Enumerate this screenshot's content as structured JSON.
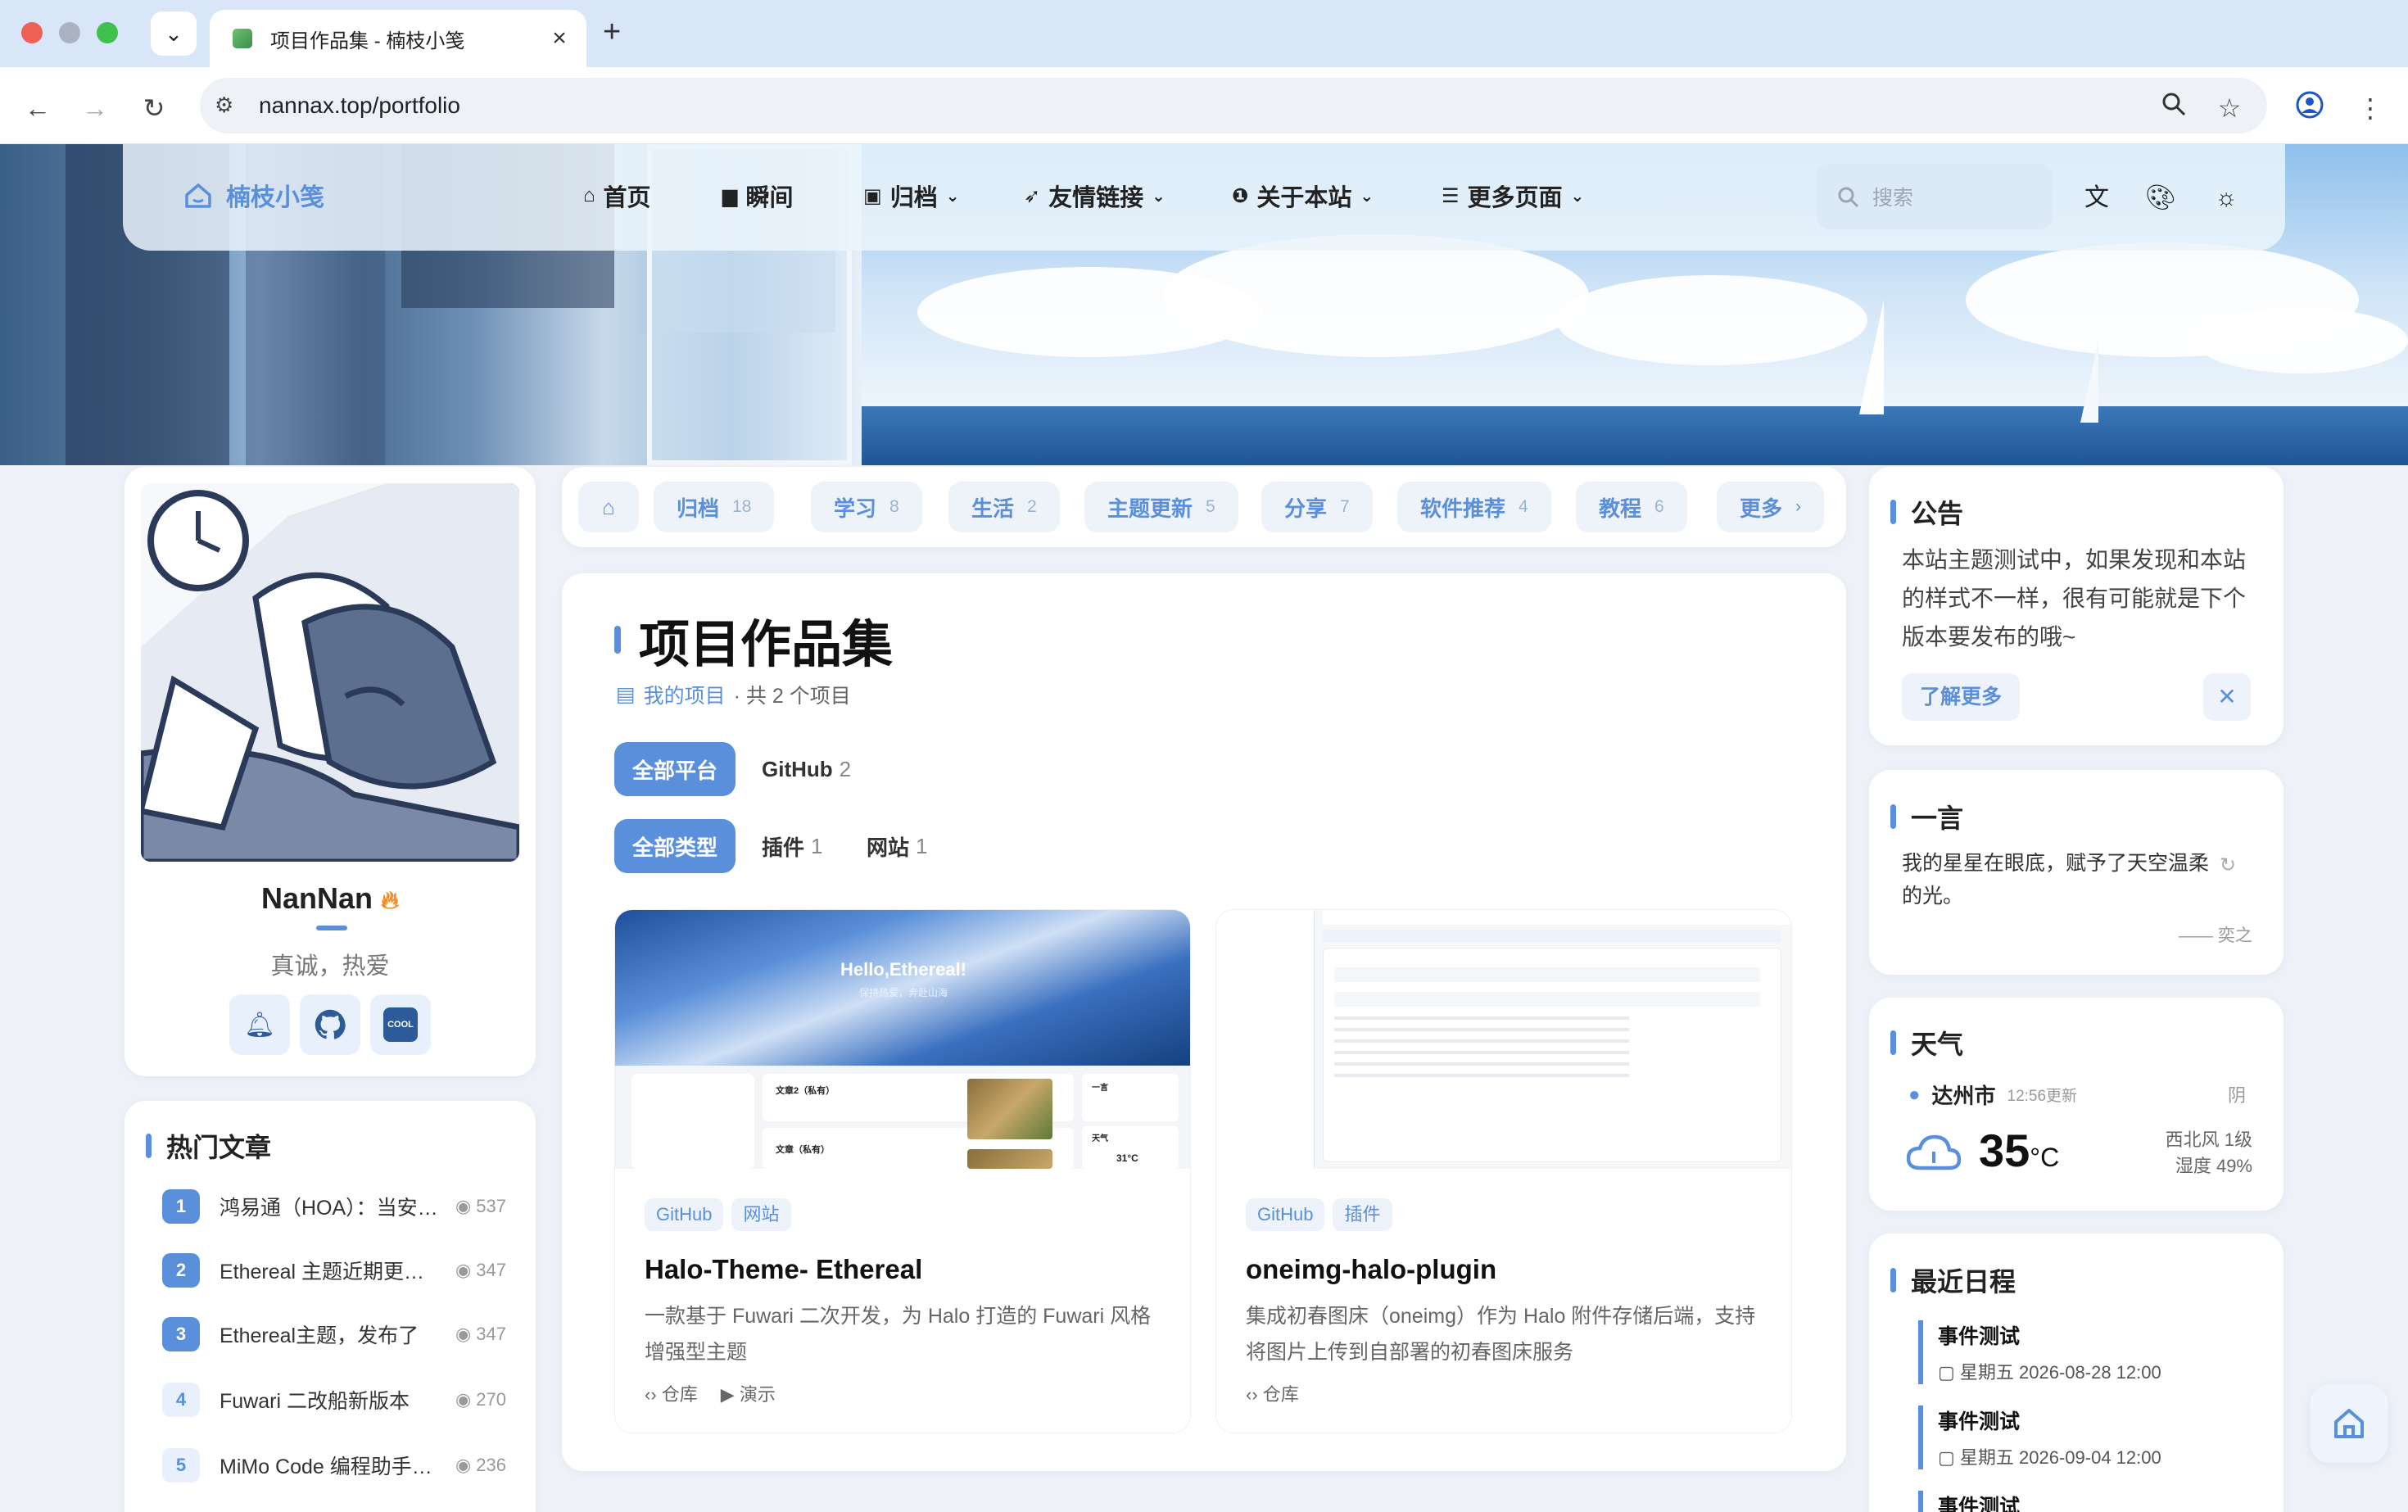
{
  "browser": {
    "tab_title": "项目作品集 - 楠枝小笺",
    "url": "nannax.top/portfolio"
  },
  "nav": {
    "logo": "楠枝小笺",
    "items": [
      {
        "label": "首页",
        "icon": "home-icon"
      },
      {
        "label": "瞬间",
        "icon": "chat-icon"
      },
      {
        "label": "归档",
        "icon": "archive-icon",
        "dropdown": true
      },
      {
        "label": "友情链接",
        "icon": "rocket-icon",
        "dropdown": true
      },
      {
        "label": "关于本站",
        "icon": "info-icon",
        "dropdown": true
      },
      {
        "label": "更多页面",
        "icon": "list-icon",
        "dropdown": true
      }
    ],
    "search_placeholder": "搜索"
  },
  "profile": {
    "name": "NanNan",
    "motto": "真诚，热爱",
    "socials": [
      "qq-icon",
      "github-icon",
      "coolapk-icon"
    ],
    "cool_label": "COOL"
  },
  "hot": {
    "title": "热门文章",
    "items": [
      {
        "rank": "1",
        "title": "鸿易通（HOA）：当安…",
        "views": "537"
      },
      {
        "rank": "2",
        "title": "Ethereal 主题近期更…",
        "views": "347"
      },
      {
        "rank": "3",
        "title": "Ethereal主题，发布了",
        "views": "347"
      },
      {
        "rank": "4",
        "title": "Fuwari 二改船新版本",
        "views": "270"
      },
      {
        "rank": "5",
        "title": "MiMo Code 编程助手…",
        "views": "236"
      }
    ]
  },
  "categories": [
    {
      "label": "归档",
      "count": "18"
    },
    {
      "label": "学习",
      "count": "8"
    },
    {
      "label": "生活",
      "count": "2"
    },
    {
      "label": "主题更新",
      "count": "5"
    },
    {
      "label": "分享",
      "count": "7"
    },
    {
      "label": "软件推荐",
      "count": "4"
    },
    {
      "label": "教程",
      "count": "6"
    },
    {
      "label": "更多",
      "count": "›"
    }
  ],
  "main": {
    "title": "项目作品集",
    "sub_link": "我的项目",
    "sub_count": "· 共 2 个项目",
    "platform_filters": [
      {
        "label": "全部平台",
        "count": ""
      },
      {
        "label": "GitHub",
        "count": "2"
      }
    ],
    "type_filters": [
      {
        "label": "全部类型",
        "count": ""
      },
      {
        "label": "插件",
        "count": "1"
      },
      {
        "label": "网站",
        "count": "1"
      }
    ],
    "projects": [
      {
        "tags": [
          "GitHub",
          "网站"
        ],
        "title": "Halo-Theme- Ethereal",
        "desc": "一款基于 Fuwari 二次开发，为 Halo 打造的 Fuwari 风格增强型主题",
        "links": [
          "仓库",
          "演示"
        ],
        "preview_text": "Hello,Ethereal!",
        "preview_sub": "保持热爱，奔赴山海",
        "preview_posts": [
          "文章2（私有）",
          "文章（私有）"
        ],
        "preview_side": [
          "一言",
          "天气"
        ],
        "preview_temp": "31°C"
      },
      {
        "tags": [
          "GitHub",
          "插件"
        ],
        "title": "oneimg-halo-plugin",
        "desc": "集成初春图床（oneimg）作为 Halo 附件存储后端，支持将图片上传到自部署的初春图床服务",
        "links": [
          "仓库"
        ]
      }
    ]
  },
  "notice": {
    "title": "公告",
    "text": "本站主题测试中，如果发现和本站的样式不一样，很有可能就是下个版本要发布的哦~",
    "button": "了解更多"
  },
  "quote": {
    "title": "一言",
    "text": "我的星星在眼底，赋予了天空温柔的光。",
    "author": "—— 奕之"
  },
  "weather": {
    "title": "天气",
    "city": "达州市",
    "updated": "12:56更新",
    "cond": "阴",
    "temp": "35",
    "unit": "°C",
    "wind": "西北风 1级",
    "humidity": "湿度 49%"
  },
  "schedule": {
    "title": "最近日程",
    "events": [
      {
        "name": "事件测试",
        "date": "星期五 2026-08-28 12:00"
      },
      {
        "name": "事件测试",
        "date": "星期五 2026-09-04 12:00"
      },
      {
        "name": "事件测试",
        "date": ""
      }
    ]
  }
}
